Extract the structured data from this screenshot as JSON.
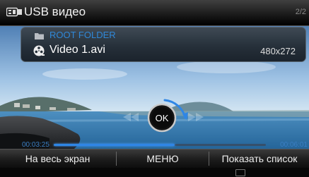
{
  "header": {
    "title": "USB видео",
    "page_indicator": "2/2",
    "source_icon": "usb-icon"
  },
  "file_info": {
    "folder_icon": "folder-icon",
    "folder_name": "ROOT FOLDER",
    "file_icon": "film-reel-icon",
    "file_name": "Video 1.avi",
    "resolution": "480x272"
  },
  "playback": {
    "elapsed": "00:03:25",
    "total": "00:06:01",
    "progress": 0.57,
    "controls": [
      "rewind-icon",
      "ok-button",
      "fast-forward-icon"
    ],
    "ok_label": "OK",
    "accent_color": "#2f86e6"
  },
  "softkeys": {
    "fullscreen": "На весь экран",
    "menu": "МЕНЮ",
    "show_list": "Показать список"
  },
  "status": {
    "bottom_icon": "logo-icon"
  }
}
